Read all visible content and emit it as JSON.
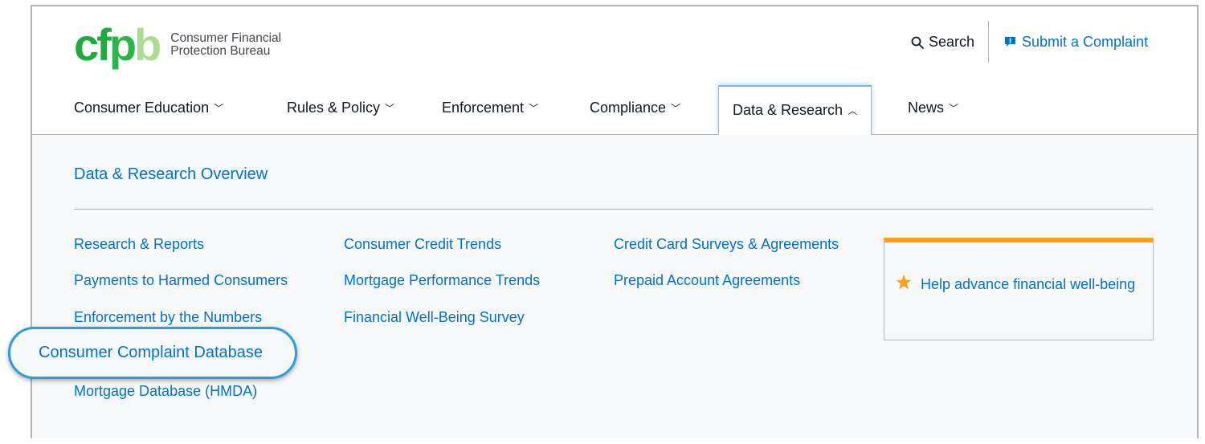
{
  "header": {
    "logo_mark": "cfpb",
    "logo_line1": "Consumer Financial",
    "logo_line2": "Protection Bureau",
    "search_label": "Search",
    "submit_label": "Submit a Complaint"
  },
  "nav": {
    "items": [
      {
        "label": "Consumer Education"
      },
      {
        "label": "Rules & Policy"
      },
      {
        "label": "Enforcement"
      },
      {
        "label": "Compliance"
      },
      {
        "label": "Data & Research"
      },
      {
        "label": "News"
      }
    ],
    "active": "Data & Research"
  },
  "panel": {
    "overview": "Data & Research Overview",
    "col1": [
      "Research & Reports",
      "Payments to Harmed Consumers",
      "Enforcement by the Numbers",
      "Consumer Complaint Database",
      "Mortgage Database (HMDA)"
    ],
    "col2": [
      "Consumer Credit Trends",
      "Mortgage Performance Trends",
      "Financial Well-Being Survey"
    ],
    "col3": [
      "Credit Card Surveys & Agreements",
      "Prepaid Account Agreements"
    ],
    "callout": "Help advance financial well-being"
  },
  "icons": {
    "search": "search-icon",
    "submit": "speech-bubble-alert-icon",
    "star": "star-icon",
    "chevron_down": "chevron-down-icon",
    "chevron_up": "chevron-up-icon"
  },
  "colors": {
    "link": "#0072ce",
    "accent_orange": "#ff9e1b",
    "logo_green": "#20aa3f",
    "highlight_ring": "#2c9fd9"
  }
}
